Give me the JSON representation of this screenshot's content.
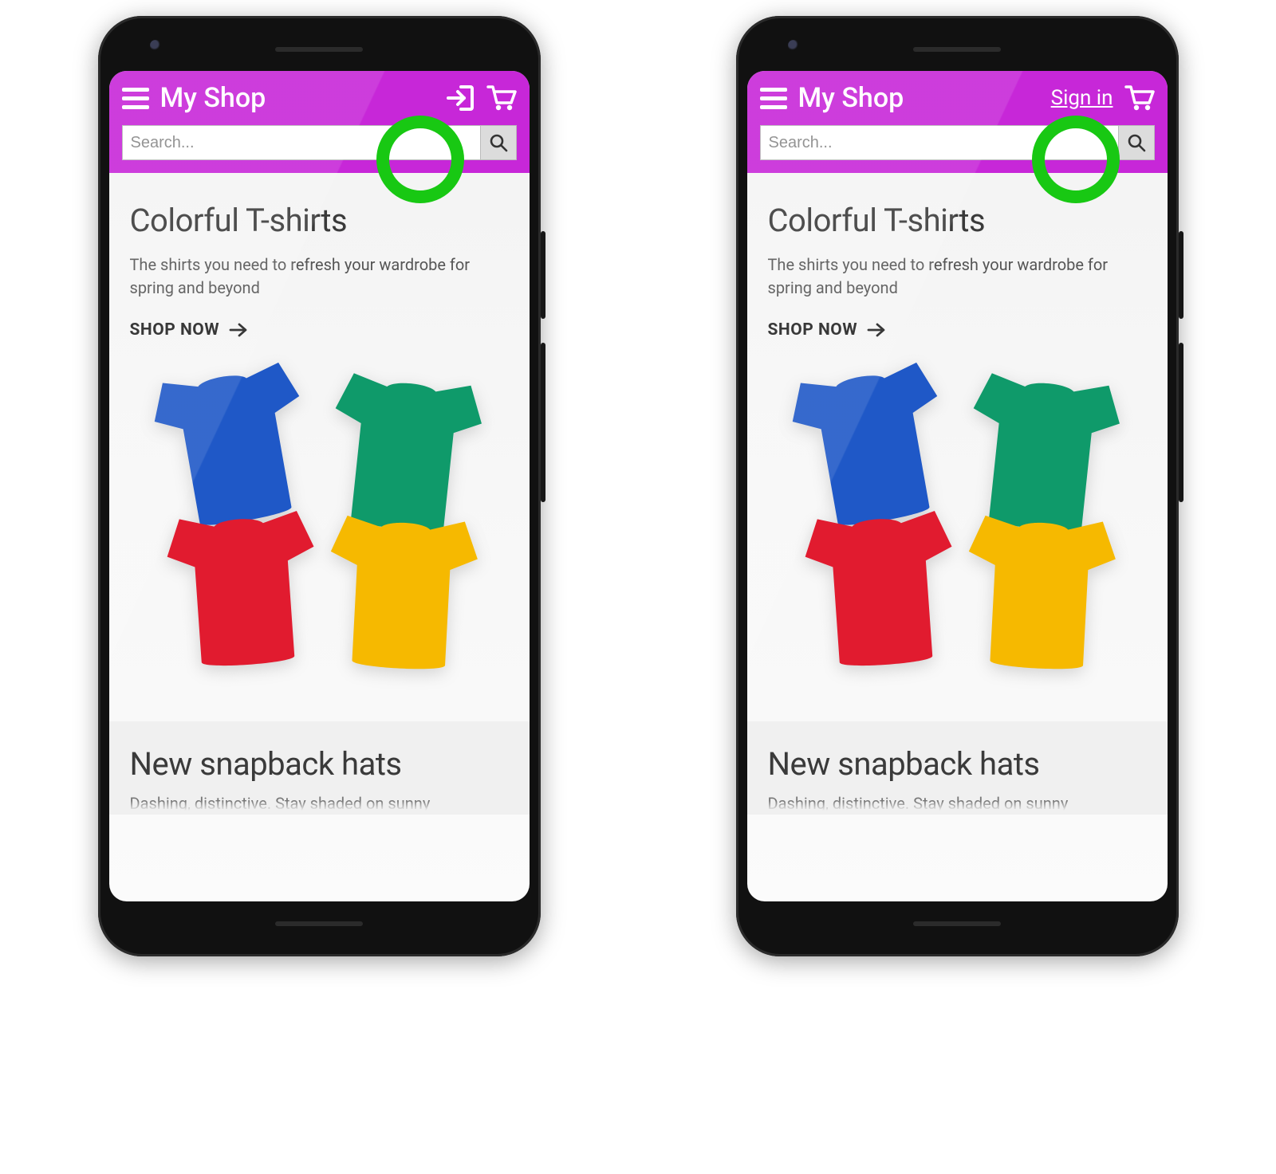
{
  "header": {
    "title": "My Shop",
    "signin_label": "Sign in",
    "search_placeholder": "Search...",
    "accent_color": "#c727d8"
  },
  "sections": [
    {
      "title": "Colorful T-shirts",
      "subtitle": "The shirts you need to refresh your wardrobe for spring and beyond",
      "cta": "SHOP NOW"
    },
    {
      "title": "New snapback hats",
      "subtitle_truncated": "Dashing, distinctive. Stay shaded on sunny"
    }
  ],
  "image_colors": {
    "blue": "#1f58c7",
    "green": "#0f9a6a",
    "red": "#e11b2f",
    "yellow": "#f6b900"
  },
  "callout_color": "#18c813"
}
